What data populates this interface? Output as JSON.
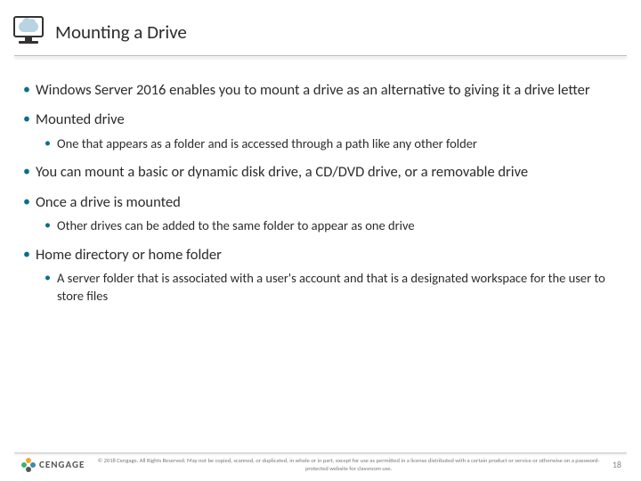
{
  "header": {
    "title": "Mounting a Drive"
  },
  "bullets": [
    {
      "text": "Windows Server 2016 enables you to mount a drive as an alternative to giving it a drive letter",
      "sub": []
    },
    {
      "text": "Mounted drive",
      "sub": [
        "One that appears as a folder and is accessed through a path like any other folder"
      ]
    },
    {
      "text": "You can mount a basic or dynamic disk drive, a CD/DVD drive, or a removable drive",
      "sub": []
    },
    {
      "text": "Once a drive is mounted",
      "sub": [
        "Other drives can be added to the same folder to appear as one drive"
      ]
    },
    {
      "text": "Home directory or home folder",
      "sub": [
        "A server folder that is associated with a user's account and that is a designated workspace for the user to store files"
      ]
    }
  ],
  "footer": {
    "brand": "CENGAGE",
    "copyright": "© 2018 Cengage. All Rights Reserved. May not be copied, scanned, or duplicated, in whole or in part, except for use as permitted in a license distributed with a certain product or service or otherwise on a password-protected website for classroom use.",
    "page": "18"
  }
}
